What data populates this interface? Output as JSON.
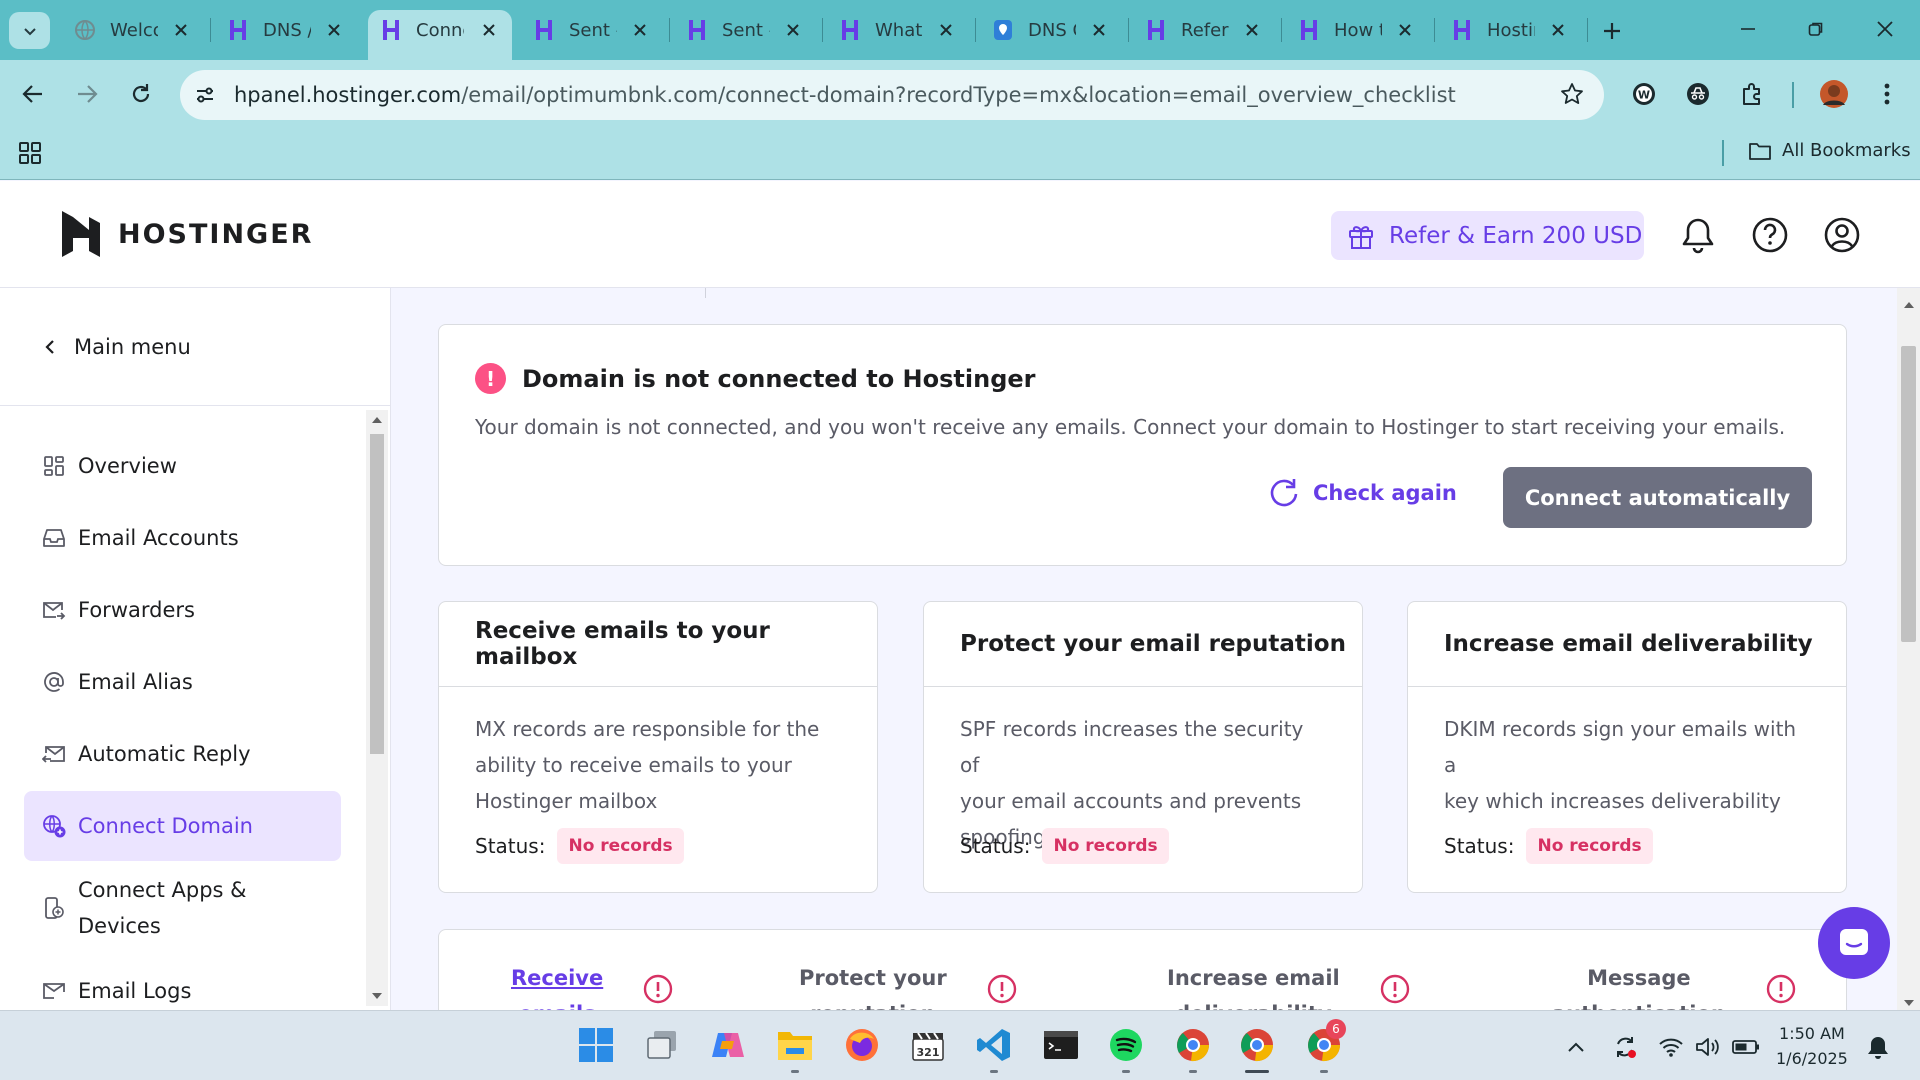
{
  "browser": {
    "tabs": [
      {
        "label": "Welco",
        "icon": "globe-icon",
        "active": false
      },
      {
        "label": "DNS /",
        "icon": "hostinger-icon",
        "active": false
      },
      {
        "label": "Conne",
        "icon": "hostinger-icon",
        "active": true
      },
      {
        "label": "Sent -",
        "icon": "hostinger-icon",
        "active": false
      },
      {
        "label": "Sent -",
        "icon": "hostinger-icon",
        "active": false
      },
      {
        "label": "What",
        "icon": "hostinger-icon",
        "active": false
      },
      {
        "label": "DNS C",
        "icon": "location-pin-icon",
        "active": false
      },
      {
        "label": "Referr",
        "icon": "hostinger-icon",
        "active": false
      },
      {
        "label": "How t",
        "icon": "hostinger-icon",
        "active": false
      },
      {
        "label": "Hostin",
        "icon": "hostinger-icon",
        "active": false
      }
    ],
    "url_host": "hpanel.hostinger.com",
    "url_path": "/email/optimumbnk.com/connect-domain?recordType=mx&location=email_overview_checklist",
    "bookmarks_label": "All Bookmarks"
  },
  "header": {
    "logo_text": "HOSTINGER",
    "refer_label": "Refer & Earn 200 USD"
  },
  "sidebar": {
    "main_menu_label": "Main menu",
    "items": [
      {
        "label": "Overview",
        "icon": "grid-icon"
      },
      {
        "label": "Email Accounts",
        "icon": "inbox-icon"
      },
      {
        "label": "Forwarders",
        "icon": "mail-forward-icon"
      },
      {
        "label": "Email Alias",
        "icon": "at-sign-icon"
      },
      {
        "label": "Automatic Reply",
        "icon": "mail-reply-icon"
      },
      {
        "label": "Connect Domain",
        "icon": "globe-plus-icon"
      },
      {
        "label": "Connect Apps &",
        "label2": "Devices",
        "icon": "device-plus-icon"
      },
      {
        "label": "Email Logs",
        "icon": "mail-log-icon"
      }
    ]
  },
  "alert": {
    "title": "Domain is not connected to Hostinger",
    "description": "Your domain is not connected, and you won't receive any emails. Connect your domain to Hostinger to start receiving your emails.",
    "check_again_label": "Check again",
    "connect_label": "Connect automatically"
  },
  "cards": [
    {
      "title": "Receive emails to your mailbox",
      "lines": [
        "MX records are responsible for the",
        "ability to receive emails to your",
        "Hostinger mailbox"
      ],
      "status_label": "Status:",
      "status_value": "No records"
    },
    {
      "title": "Protect your email reputation",
      "lines": [
        "SPF records increases the security of",
        "your email accounts and prevents",
        "spoofing"
      ],
      "status_label": "Status:",
      "status_value": "No records"
    },
    {
      "title": "Increase email deliverability",
      "lines": [
        "DKIM records sign your emails with a",
        "key which increases deliverability"
      ],
      "status_label": "Status:",
      "status_value": "No records"
    }
  ],
  "steps": [
    {
      "line1": "Receive",
      "line2": "emails",
      "active": true
    },
    {
      "line1": "Protect your",
      "line2": "reputation",
      "active": false
    },
    {
      "line1": "Increase email",
      "line2": "deliverability",
      "active": false
    },
    {
      "line1": "Message",
      "line2": "authentication",
      "active": false
    }
  ],
  "taskbar": {
    "apps": [
      "windows-start-icon",
      "task-view-icon",
      "copilot-icon",
      "file-explorer-icon",
      "firefox-icon",
      "clapper-icon",
      "vscode-icon",
      "terminal-icon",
      "spotify-icon",
      "chrome-icon",
      "chrome-icon",
      "chrome-icon"
    ],
    "chrome_badge": "6",
    "time": "1:50 AM",
    "date": "1/6/2025"
  },
  "colors": {
    "brand": "#673de6",
    "browser_frame": "#5bbec6",
    "toolbar": "#aee1e6",
    "warning": "#fc5185",
    "connect_button": "#6d7081"
  }
}
